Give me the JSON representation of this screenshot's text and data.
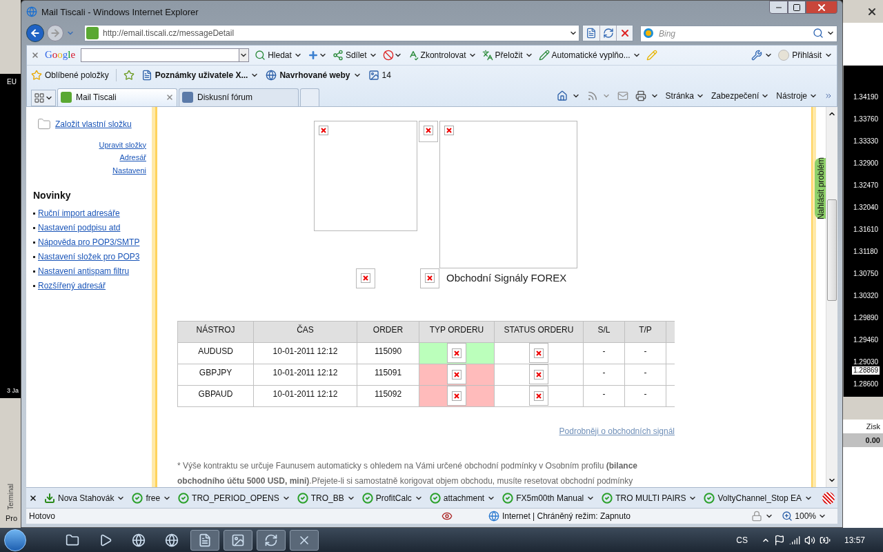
{
  "left_app": {
    "symbol": "EU",
    "date": "3 Ja",
    "panel": "Terminal",
    "tab": "Pro"
  },
  "right_app": {
    "prices": [
      "1.34190",
      "1.33760",
      "1.33330",
      "1.32900",
      "1.32470",
      "1.32040",
      "1.31610",
      "1.31180",
      "1.30750",
      "1.30320",
      "1.29890",
      "1.29460",
      "1.29030",
      "1.28600"
    ],
    "current_price": "1.28869",
    "column": "Zisk",
    "value": "0.00"
  },
  "window": {
    "title": "Mail Tiscali - Windows Internet Explorer"
  },
  "address_bar": {
    "url": "http://email.tiscali.cz/messageDetail"
  },
  "search": {
    "placeholder": "Bing"
  },
  "google_toolbar": {
    "logo": "Google",
    "items": [
      "Hledat",
      "Sdílet",
      "Zkontrolovat",
      "Přeložit",
      "Automatické vyplňo..."
    ],
    "sign_in": "Přihlásit"
  },
  "favorites_bar": {
    "title": "Oblíbené položky",
    "items": [
      "Poznámky uživatele X...",
      "Navrhované weby",
      "14"
    ]
  },
  "tabs": [
    {
      "label": "Mail Tiscali",
      "selected": true
    },
    {
      "label": "Diskusní fórum",
      "selected": false
    }
  ],
  "command_bar": [
    "Stránka",
    "Zabezpečení",
    "Nástroje"
  ],
  "sidebar": {
    "create_folder": "Založit vlastní složku",
    "links": [
      "Upravit složky",
      "Adresář",
      "Nastaveni"
    ],
    "news_title": "Novinky",
    "news": [
      "Ruční import adresáře",
      "Nastavení podpisu atd",
      "Nápověda pro POP3/SMTP",
      "Nastavení složek pro POP3",
      "Nastavení antispam filtru",
      "Rozšířený adresář"
    ]
  },
  "message": {
    "heading": "Obchodní Signály FOREX",
    "table": {
      "columns": [
        "NÁSTROJ",
        "ČAS",
        "ORDER",
        "TYP ORDERU",
        "STATUS ORDERU",
        "S/L",
        "T/P"
      ],
      "rows": [
        {
          "instrument": "AUDUSD",
          "time": "10-01-2011 12:12",
          "order": "115090",
          "color": "#bbffbb",
          "sl": "-",
          "tp": "-"
        },
        {
          "instrument": "GBPJPY",
          "time": "10-01-2011 12:12",
          "order": "115091",
          "color": "#ffbbbb",
          "sl": "-",
          "tp": "-"
        },
        {
          "instrument": "GBPAUD",
          "time": "10-01-2011 12:12",
          "order": "115092",
          "color": "#ffbbbb",
          "sl": "-",
          "tp": "-"
        }
      ]
    },
    "more_link": "Podrobněji o obchodních signál",
    "footnote_lines": [
      "* Výše kontraktu se určuje Faunusem automaticky s ohledem na Vámi určené obchodní podmínky v Osobním profilu **(bilance**",
      "**obchodního účtu 5000 USD, mini)**.Přejete-li si samostatně korigovat objem obchodu, musíte resetovat obchodní podmínky"
    ]
  },
  "report_tab": "Nahlásit problém",
  "addon_bar": [
    {
      "label": "Nova Stahovák",
      "kind": "download"
    },
    {
      "label": "free",
      "kind": "check"
    },
    {
      "label": "TRO_PERIOD_OPENS",
      "kind": "check"
    },
    {
      "label": "TRO_BB",
      "kind": "check"
    },
    {
      "label": "ProfitCalc",
      "kind": "check"
    },
    {
      "label": "attachment",
      "kind": "check"
    },
    {
      "label": "FX5m00th Manual",
      "kind": "check"
    },
    {
      "label": "TRO MULTI PAIRS",
      "kind": "check"
    },
    {
      "label": "VoltyChannel_Stop EA",
      "kind": "check"
    }
  ],
  "status_bar": {
    "status": "Hotovo",
    "zone": "Internet | Chráněný režim: Zapnuto",
    "zoom": "100%"
  },
  "taskbar": {
    "language": "CS",
    "time": "13:57"
  }
}
